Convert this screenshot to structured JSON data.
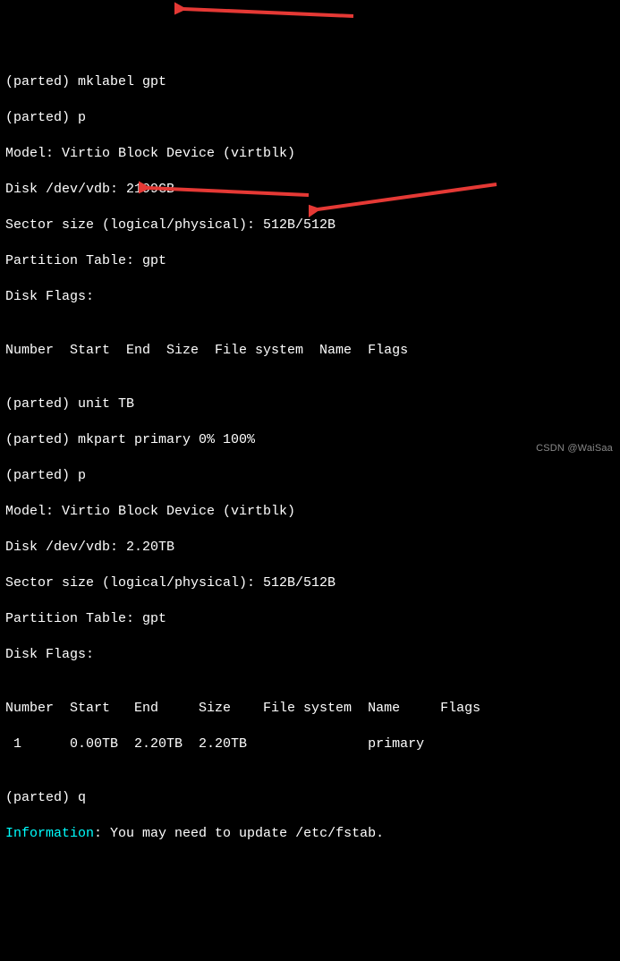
{
  "lines": {
    "l01": "(parted) mklabel gpt",
    "l02": "(parted) p",
    "l03": "Model: Virtio Block Device (virtblk)",
    "l04": "Disk /dev/vdb: 2199GB",
    "l05": "Sector size (logical/physical): 512B/512B",
    "l06": "Partition Table: gpt",
    "l07": "Disk Flags:",
    "l08": "",
    "l09": "Number  Start  End  Size  File system  Name  Flags",
    "l10": "",
    "l11": "(parted) unit TB",
    "l12": "(parted) mkpart primary 0% 100%",
    "l13": "(parted) p",
    "l14": "Model: Virtio Block Device (virtblk)",
    "l15": "Disk /dev/vdb: 2.20TB",
    "l16": "Sector size (logical/physical): 512B/512B",
    "l17": "Partition Table: gpt",
    "l18": "Disk Flags:",
    "l19": "",
    "l20": "Number  Start   End     Size    File system  Name     Flags",
    "l21": " 1      0.00TB  2.20TB  2.20TB               primary",
    "l22": "",
    "l23": "(parted) q",
    "info_label": "Information",
    "info_tail": ": You may need to update /etc/fstab."
  },
  "watermark": "CSDN @WaiSaa",
  "annotation_color": "#e53935"
}
